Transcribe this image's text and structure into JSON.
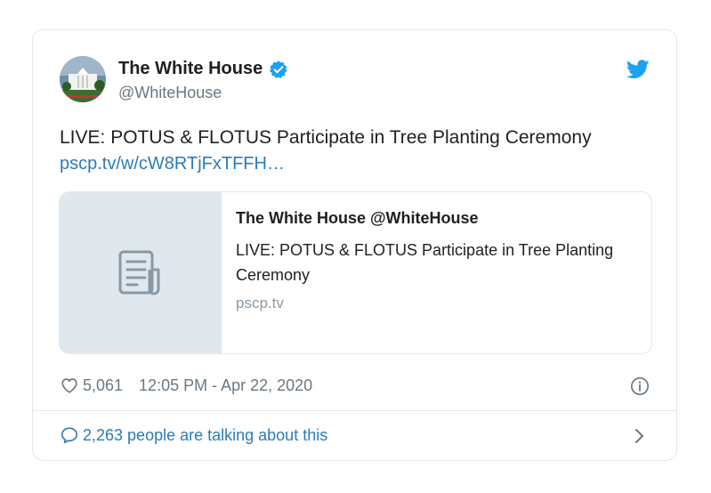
{
  "author": {
    "name": "The White House",
    "handle": "@WhiteHouse"
  },
  "tweet": {
    "text": "LIVE: POTUS & FLOTUS Participate in Tree Planting Ceremony",
    "link": "pscp.tv/w/cW8RTjFxTFFH…"
  },
  "link_card": {
    "title": "The White House @WhiteHouse",
    "description": "LIVE: POTUS & FLOTUS Participate in Tree Planting Ceremony",
    "domain": "pscp.tv"
  },
  "meta": {
    "likes": "5,061",
    "timestamp": "12:05 PM - Apr 22, 2020"
  },
  "conversation": {
    "label": "2,263 people are talking about this"
  },
  "icons": {
    "verified": "verified-badge-icon",
    "brand": "twitter-bird-icon",
    "like": "heart-icon",
    "info": "info-icon",
    "reply": "speech-bubble-icon",
    "chevron": "chevron-right-icon",
    "document": "document-icon"
  },
  "colors": {
    "accent": "#1da1f2",
    "link": "#2b7bb9",
    "muted": "#697882",
    "border": "#e1e8ed"
  }
}
